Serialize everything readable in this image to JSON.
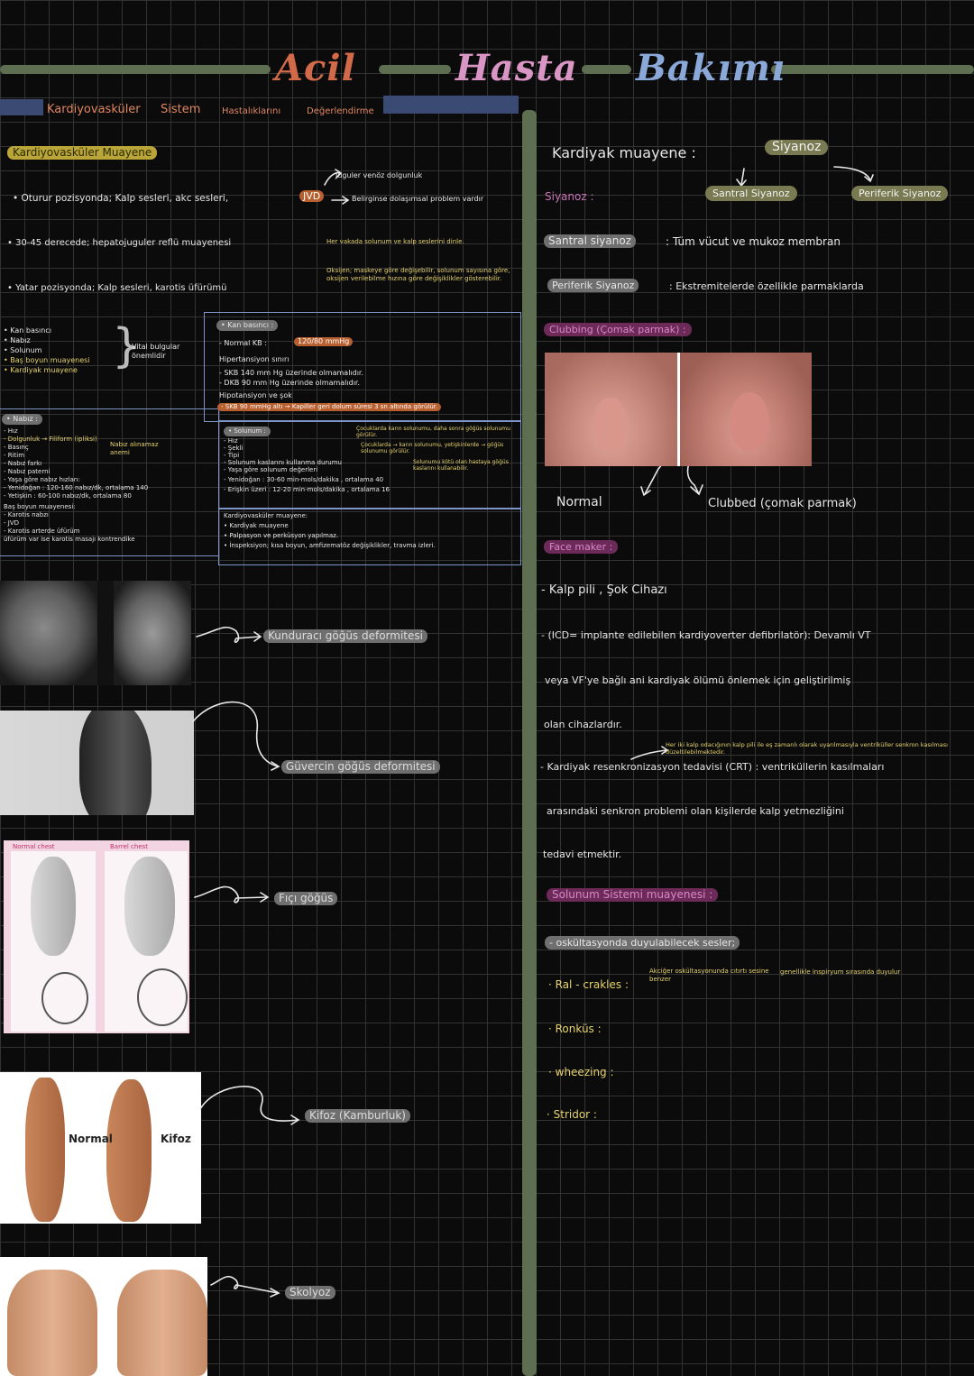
{
  "title": {
    "w1": "Acil",
    "w2": "Hasta",
    "w3": "Bakımı"
  },
  "subtitle": {
    "a": "Kardiyovasküler",
    "b": "Sistem",
    "c": "Hastalıklarını",
    "d": "Değerlendirme"
  },
  "left": {
    "heading": "Kardiyovasküler Muayene",
    "l1": "• Oturur pozisyonda; Kalp sesleri, akc sesleri,",
    "jvd": "JVD",
    "l1b": "Belirginse dolaşımsal problem vardır",
    "l1c": "Juguler venöz dolgunluk",
    "l2": "• 30-45 derecede; hepatojuguler reflü muayenesi",
    "l3": "• Yatar pozisyonda; Kalp sesleri, karotis üfürümü",
    "note1": "Her vakada solunum ve kalp seslerini dinle.",
    "note2": "Oksijen; maskeye göre değişebilir, solunum sayısına göre, oksijen verilebilme hızına göre değişiklikler gösterebilir.",
    "vital_list": [
      "• Kan basıncı",
      "• Nabız",
      "• Solunum",
      "• Baş boyun muayenesi",
      "• Kardiyak muayene"
    ],
    "vital_note": "Vital bulgular önemlidir",
    "bp": {
      "head": "• Kan basıncı :",
      "normal_label": "- Normal KB :",
      "normal_val": "120/80 mmHg",
      "hyper": "Hipertansiyon sınırı",
      "skb": "- SKB 140 mm Hg üzerinde olmamalıdır.",
      "dkb": "- DKB 90 mm Hg üzerinde olmamalıdır.",
      "hypo": "Hipotansiyon ve şok",
      "skb90": "- SKB 90 mmHg altı → Kapiller geri dolum süresi 3 sn altında görülür."
    },
    "pulse": {
      "head": "• Nabız :",
      "items": [
        "- Hız",
        "- Dolgunluk → Filiform (ipliksi)",
        "- Basınç",
        "- Ritim",
        "- Nabız farkı",
        "- Nabız paterni",
        "- Yaşa göre nabız hızları:",
        "- Yenidoğan : 120-160 nabız/dk, ortalama 140",
        "- Yetişkin : 60-100 nabız/dk, ortalama 80"
      ],
      "filiform_note": "Nabız alınamaz anemi",
      "bas": "Baş boyun muayenesi:",
      "bas_items": [
        "- Karotis nabzı",
        "- JVD",
        "- Karotis arterde üfürüm",
        "üfürüm var ise karotis masajı kontrendike"
      ]
    },
    "resp": {
      "head": "• Solunum :",
      "items": [
        "- Hız",
        "- Şekli",
        "- Tipi",
        "- Solunum kaslarını kullanma durumu",
        "- Yaşa göre solunum değerleri",
        "- Yenidoğan : 30-60 min-mols/dakika , ortalama 40",
        "- Erişkin üzeri : 12-20 min-mols/dakika , ortalama 16"
      ],
      "note_a": "Çocuklarda karın solunumu, daha sonra göğüs solunumu görülür.",
      "note_b": "Çocuklarda → karın solunumu, yetişkinlerde → göğüs solunumu görülür.",
      "note_c": "Solunumu kötü olan hastaya göğüs kaslarını kullanabilir."
    },
    "cardio": {
      "head": "Kardiyovasküler muayene:",
      "items": [
        "• Kardiyak muayene",
        "• Palpasyon ve perküsyon yapılmaz.",
        "• İnspeksiyon; kısa boyun, amfizematöz değişiklikler, travma izleri."
      ]
    },
    "deformities": [
      {
        "label": "Kunduracı göğüs deformitesi"
      },
      {
        "label": "Güvercin göğüs deformitesi"
      },
      {
        "label": "Fıçı göğüs"
      },
      {
        "label": "Kifoz (Kamburluk)"
      },
      {
        "label": "Skolyoz"
      }
    ],
    "barrel_labels": {
      "left": "Normal chest",
      "right": "Barrel chest"
    },
    "kifoz_labels": {
      "left": "Normal",
      "right": "Kifoz"
    }
  },
  "right": {
    "heading": "Kardiyak muayene :",
    "siyanoz_top": "Siyanoz",
    "siyanoz_label": "Siyanoz :",
    "santral_bubble": "Santral Siyanoz",
    "periferik_bubble": "Periferik Siyanoz",
    "santral_label": "Santral siyanoz",
    "santral_text": ": Tüm vücut ve mukoz membran",
    "periferik_label": "Periferik Siyanoz",
    "periferik_text": ": Ekstremitelerde özellikle parmaklarda",
    "clubbing": "Clubbing (Çomak parmak) :",
    "normal": "Normal",
    "clubbed": "Clubbed (çomak parmak)",
    "face": "Face maker :",
    "kalp_pili": "- Kalp pili , Şok Cihazı",
    "icd1": "- (ICD= implante edilebilen kardiyoverter defibrilatör): Devamlı VT",
    "icd2": "veya VF'ye bağlı ani kardiyak ölümü önlemek için geliştirilmiş",
    "icd3": "olan cihazlardır.",
    "crt_note": "Her iki kalp odacığının kalp pili ile eş zamanlı olarak uyarılmasıyla ventriküller senkron kasılması düzeltilebilmektedir.",
    "crt1": "- Kardiyak resenkronizasyon tedavisi (CRT) : ventriküllerin kasılmaları",
    "crt2": "arasındaki senkron problemi olan kişilerde kalp yetmezliğini",
    "crt3": "tedavi etmektir.",
    "solunum": "Solunum Sistemi muayenesi :",
    "oskult": "- oskültasyonda duyulabilecek sesler;",
    "ral": "· Ral - crakles :",
    "ral_note": "Akciğer oskültasyonunda cıtırtı sesine benzer",
    "ral_note2": "genellikle inspiryum sırasında duyulur",
    "ronkus": "· Ronküs :",
    "wheezing": "· wheezing :",
    "stridor": "· Stridor :"
  }
}
